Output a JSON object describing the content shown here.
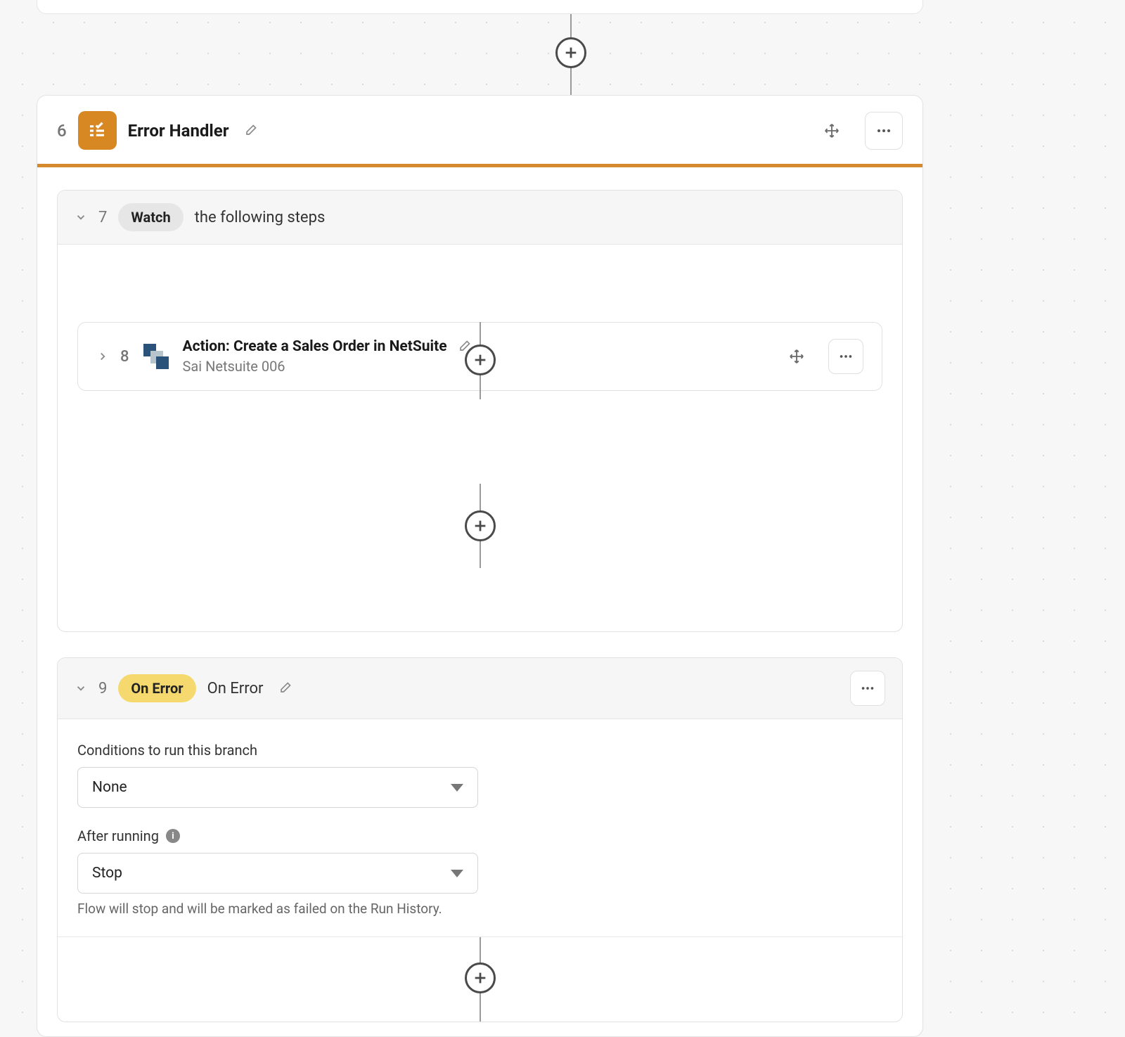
{
  "step6": {
    "num": "6",
    "title": "Error Handler"
  },
  "step7": {
    "num": "7",
    "pill": "Watch",
    "text": "the following steps"
  },
  "step8": {
    "num": "8",
    "title": "Action: Create a Sales Order in NetSuite",
    "subtitle": "Sai Netsuite 006"
  },
  "step9": {
    "num": "9",
    "pill": "On Error",
    "label": "On Error",
    "conditions_label": "Conditions to run this branch",
    "conditions_value": "None",
    "after_label": "After running",
    "after_value": "Stop",
    "help": "Flow will stop and will be marked as failed on the Run History."
  }
}
